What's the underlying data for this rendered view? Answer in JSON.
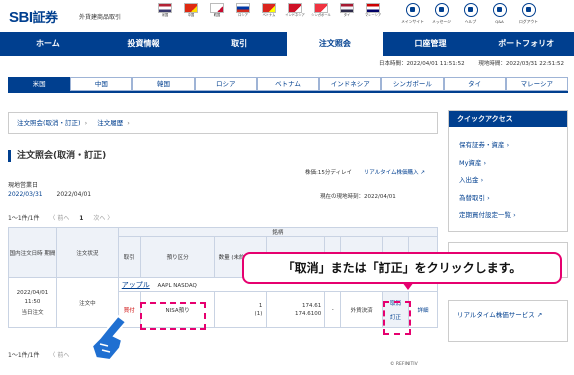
{
  "header": {
    "logo_sbi": "SBI",
    "logo_kanji": "証券",
    "subtitle": "外貨建商品取引",
    "flags": [
      {
        "label": "米国",
        "colors": [
          "#b22234",
          "#ffffff",
          "#3c3b6e"
        ]
      },
      {
        "label": "中国",
        "colors": [
          "#de2910",
          "#ffde00"
        ]
      },
      {
        "label": "韓国",
        "colors": [
          "#ffffff",
          "#c60c30"
        ]
      },
      {
        "label": "ロシア",
        "colors": [
          "#ffffff",
          "#0039a6",
          "#d52b1e"
        ]
      },
      {
        "label": "ベトナム",
        "colors": [
          "#da251d",
          "#ffff00"
        ]
      },
      {
        "label": "インドネシア",
        "colors": [
          "#ce1126",
          "#ffffff"
        ]
      },
      {
        "label": "シンガポール",
        "colors": [
          "#ef3340",
          "#ffffff"
        ]
      },
      {
        "label": "タイ",
        "colors": [
          "#a51931",
          "#f4f5f8",
          "#2d2a4a"
        ]
      },
      {
        "label": "マレーシア",
        "colors": [
          "#cc0001",
          "#ffffff",
          "#010066"
        ]
      }
    ],
    "utilities": [
      {
        "label": "メインサイト",
        "icon": "home-icon"
      },
      {
        "label": "メッセージ",
        "icon": "mail-icon"
      },
      {
        "label": "ヘルプ",
        "icon": "help-icon"
      },
      {
        "label": "Q&A",
        "icon": "qa-icon"
      },
      {
        "label": "ログアウト",
        "icon": "logout-icon"
      }
    ]
  },
  "nav": [
    "ホーム",
    "投資情報",
    "取引",
    "注文照会",
    "口座管理",
    "ポートフォリオ"
  ],
  "nav_active": "注文照会",
  "times": {
    "japan": "日本時間：2022/04/01 11:51:52",
    "local": "現地時間：2022/03/31 22:51:52"
  },
  "country_tabs": [
    "米国",
    "中国",
    "韓国",
    "ロシア",
    "ベトナム",
    "インドネシア",
    "シンガポール",
    "タイ",
    "マレーシア"
  ],
  "breadcrumb": [
    "注文照会(取消・訂正)",
    "注文履歴"
  ],
  "page_title": "注文照会(取消・訂正)",
  "price_note": {
    "delay": "株価:15分ディレイ",
    "realtime": "リアルタイム株価購入"
  },
  "business_day": {
    "label": "現地営業日",
    "local": "2022/03/31",
    "japan": "2022/04/01"
  },
  "local_date_note": "現在の現地時刻：2022/04/01",
  "pager": {
    "count": "1〜1件/1件",
    "prev": "〈 前へ",
    "page": "1",
    "next": "次へ 〉"
  },
  "table": {
    "h_order_date": "国内注文日時 期間",
    "h_status": "注文状況",
    "h_brand": "銘柄",
    "h_trade": "取引",
    "h_custody": "預り区分",
    "h_qty": "数量 (未約定数量)",
    "h_price": "",
    "h_cancel": "",
    "h_detail": "",
    "stock_name": "アップル",
    "stock_code": "AAPL NASDAQ",
    "order_date": "2022/04/01",
    "order_time": "11:50",
    "order_period": "当日注文",
    "status": "注文中",
    "trade": "買付",
    "custody": "NISA預り",
    "qty": "1",
    "unfilled": "(1)",
    "price1": "174.61",
    "price2": "174.6100",
    "dash": "-",
    "settlement": "外貨決済",
    "cancel": "取消",
    "correct": "訂正",
    "detail": "詳細"
  },
  "refinitiv": "© REFINITIV",
  "quick_access": {
    "title": "クイックアクセス",
    "links": [
      "保有証券・資産",
      "My資産",
      "入出金",
      "為替取引",
      "定期買付設定一覧"
    ]
  },
  "realtime_service": "リアルタイム株価サービス",
  "callout": "「取消」または「訂正」をクリックします。",
  "accent_color": "#003f8f",
  "highlight_color": "#e6006f"
}
